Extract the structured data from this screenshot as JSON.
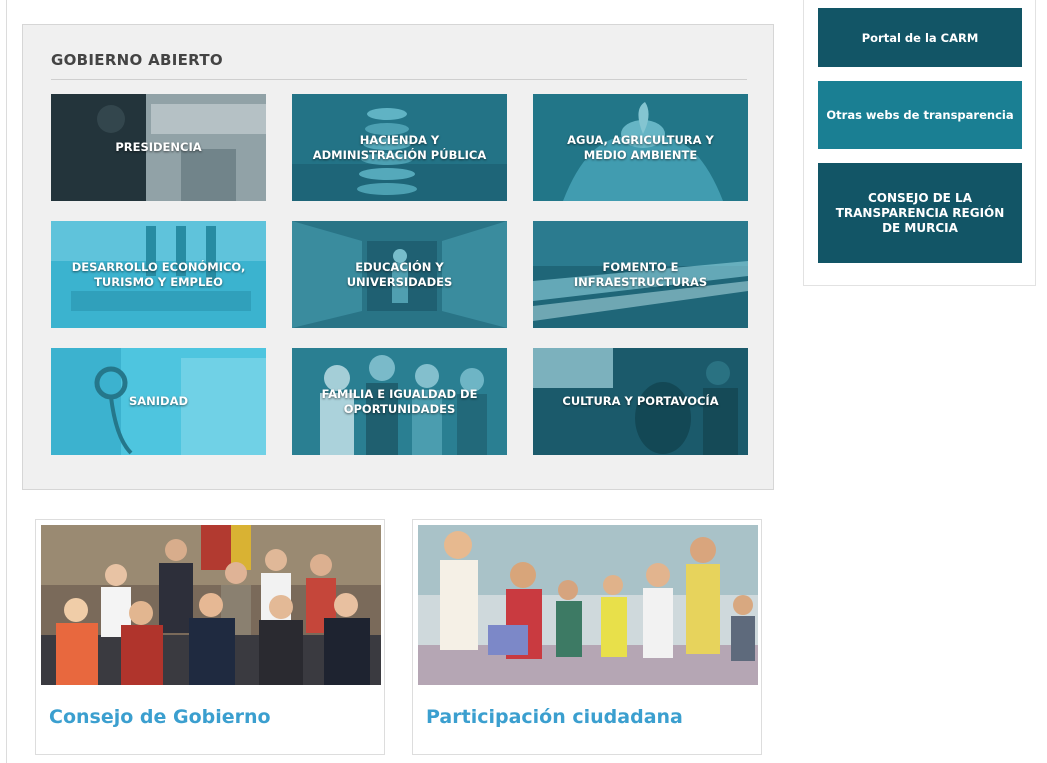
{
  "gobierno_abierto": {
    "title": "GOBIERNO ABIERTO",
    "tiles": [
      {
        "label": "PRESIDENCIA",
        "icon": "presidency-photo",
        "color": "#1d3a44"
      },
      {
        "label": "HACIENDA Y ADMINISTRACIÓN PÚBLICA",
        "icon": "coins-photo",
        "color": "#2a7f91"
      },
      {
        "label": "AGUA, AGRICULTURA Y MEDIO AMBIENTE",
        "icon": "hands-plant-photo",
        "color": "#2e8ea2"
      },
      {
        "label": "DESARROLLO ECONÓMICO, TURISMO Y EMPLEO",
        "icon": "office-photo",
        "color": "#3cb3cf"
      },
      {
        "label": "EDUCACIÓN Y UNIVERSIDADES",
        "icon": "library-photo",
        "color": "#2e8396"
      },
      {
        "label": "FOMENTO E INFRAESTRUCTURAS",
        "icon": "highway-photo",
        "color": "#27788c"
      },
      {
        "label": "SANIDAD",
        "icon": "stethoscope-photo",
        "color": "#45bfdc"
      },
      {
        "label": "FAMILIA E IGUALDAD DE OPORTUNIDADES",
        "icon": "family-photo",
        "color": "#2c8599"
      },
      {
        "label": "CULTURA Y PORTAVOCÍA",
        "icon": "orchestra-photo",
        "color": "#216b7c"
      }
    ]
  },
  "sidebar": {
    "buttons": [
      {
        "label": "Portal de la CARM",
        "color": "#125566"
      },
      {
        "label": "Otras webs de transparencia",
        "color": "#1a7f93"
      },
      {
        "label": "CONSEJO DE LA TRANSPARENCIA REGIÓN DE MURCIA",
        "color": "#125566"
      }
    ]
  },
  "cards": [
    {
      "title": "Consejo de Gobierno",
      "icon": "government-group-photo"
    },
    {
      "title": "Participación ciudadana",
      "icon": "citizens-mural-photo"
    }
  ],
  "colors": {
    "link": "#3b9fcf",
    "panel_bg": "#f0f0f0"
  }
}
